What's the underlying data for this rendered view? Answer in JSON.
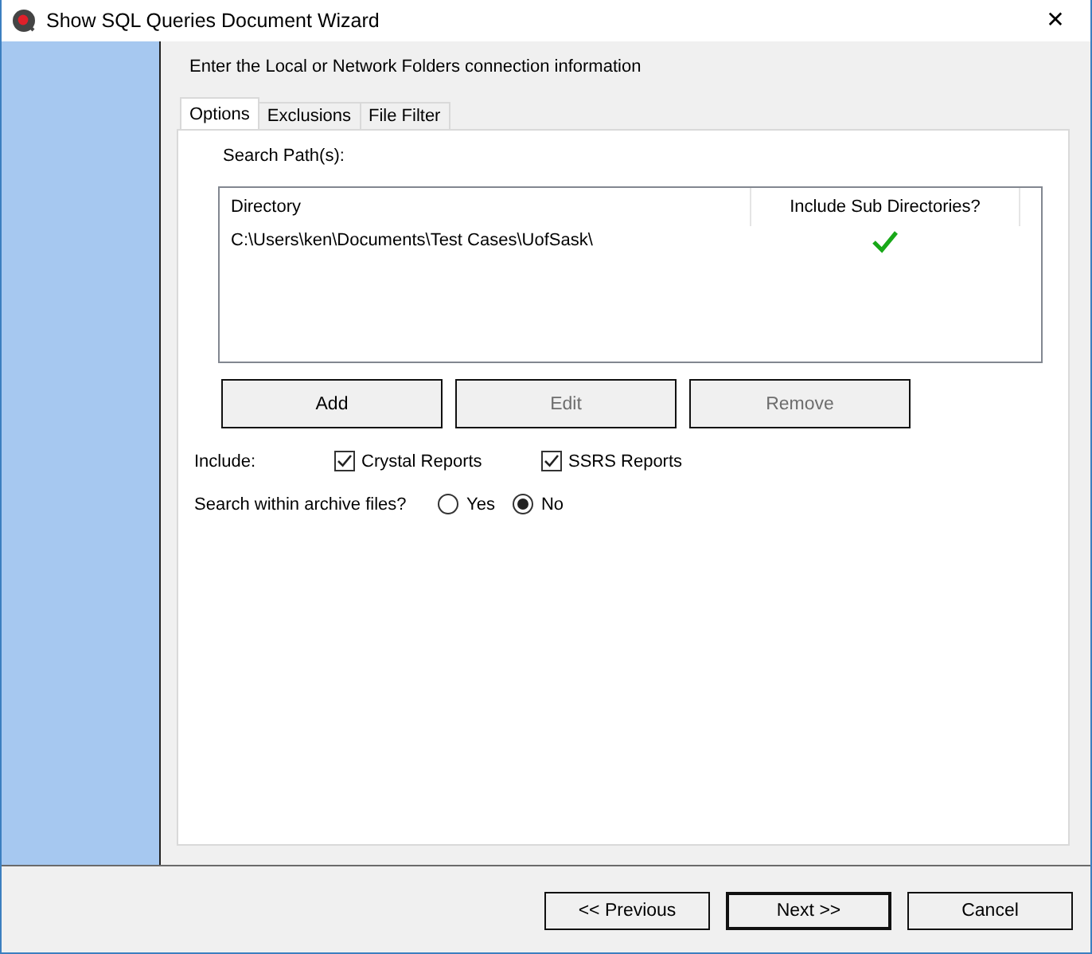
{
  "window": {
    "title": "Show SQL Queries Document Wizard",
    "close": "✕"
  },
  "instruction": "Enter the Local or Network Folders connection information",
  "tabs": [
    {
      "label": "Options",
      "selected": true
    },
    {
      "label": "Exclusions",
      "selected": false
    },
    {
      "label": "File Filter",
      "selected": false
    }
  ],
  "search_paths_label": "Search Path(s):",
  "paths_table": {
    "columns": [
      "Directory",
      "Include Sub Directories?"
    ],
    "rows": [
      {
        "directory": "C:\\Users\\ken\\Documents\\Test Cases\\UofSask\\",
        "include_sub": true
      }
    ]
  },
  "path_buttons": [
    {
      "label": "Add",
      "disabled": false
    },
    {
      "label": "Edit",
      "disabled": true
    },
    {
      "label": "Remove",
      "disabled": true
    }
  ],
  "include": {
    "label": "Include:",
    "options": [
      {
        "label": "Crystal Reports",
        "checked": true
      },
      {
        "label": "SSRS Reports",
        "checked": true
      }
    ]
  },
  "archive": {
    "label": "Search within archive files?",
    "options": [
      {
        "label": "Yes",
        "selected": false
      },
      {
        "label": "No",
        "selected": true
      }
    ]
  },
  "footer_buttons": [
    {
      "label": "<< Previous",
      "default": false
    },
    {
      "label": "Next >>",
      "default": true
    },
    {
      "label": "Cancel",
      "default": false
    }
  ]
}
